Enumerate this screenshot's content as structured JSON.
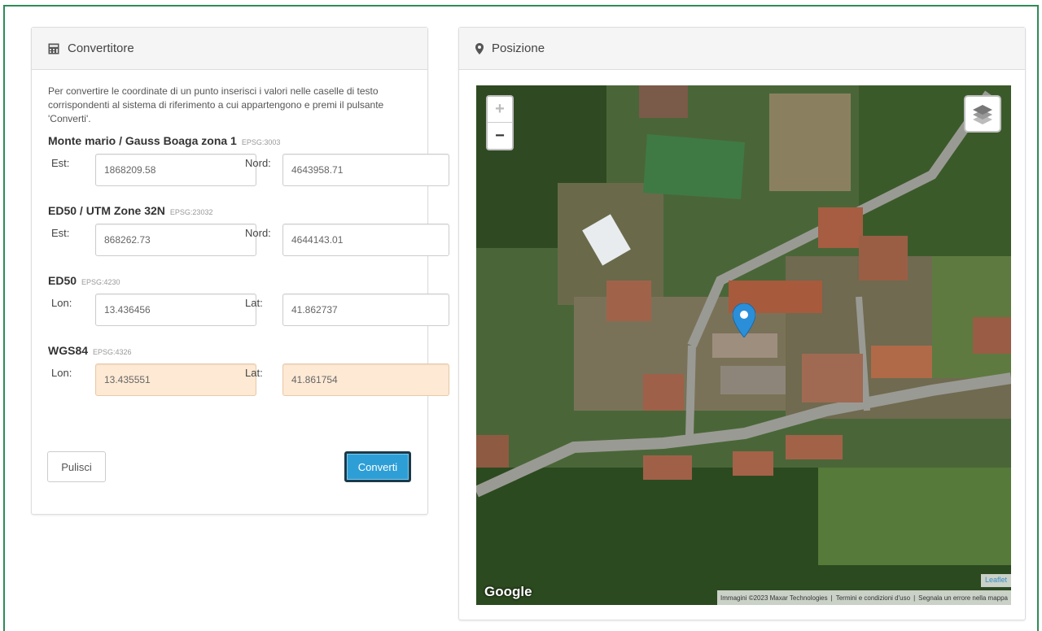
{
  "converter": {
    "title": "Convertitore",
    "intro": "Per convertire le coordinate di un punto inserisci i valori nelle caselle di testo corrispondenti al sistema di riferimento a cui appartengono e premi il pulsante 'Converti'.",
    "systems": [
      {
        "name": "Monte mario / Gauss Boaga zona 1",
        "epsg": "EPSG:3003",
        "label1": "Est:",
        "value1": "1868209.58",
        "label2": "Nord:",
        "value2": "4643958.71"
      },
      {
        "name": "ED50 / UTM Zone 32N",
        "epsg": "EPSG:23032",
        "label1": "Est:",
        "value1": "868262.73",
        "label2": "Nord:",
        "value2": "4644143.01"
      },
      {
        "name": "ED50",
        "epsg": "EPSG:4230",
        "label1": "Lon:",
        "value1": "13.436456",
        "label2": "Lat:",
        "value2": "41.862737"
      },
      {
        "name": "WGS84",
        "epsg": "EPSG:4326",
        "label1": "Lon:",
        "value1": "13.435551",
        "label2": "Lat:",
        "value2": "41.861754"
      }
    ],
    "clear_label": "Pulisci",
    "convert_label": "Converti"
  },
  "position": {
    "title": "Posizione",
    "google_logo": "Google",
    "attribution": [
      "Immagini ©2023 Maxar Technologies",
      "Termini e condizioni d'uso",
      "Segnala un errore nella mappa"
    ],
    "leaflet": "Leaflet",
    "zoom_in": "+",
    "zoom_out": "−"
  },
  "colors": {
    "accent": "#2e9fd6",
    "frame": "#2e8b57",
    "output_field": "#fde9d4",
    "marker": "#2a8fd8"
  }
}
